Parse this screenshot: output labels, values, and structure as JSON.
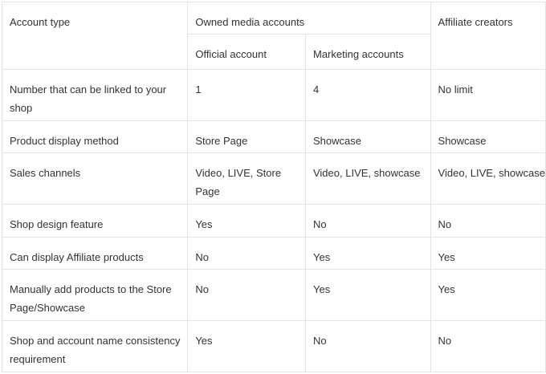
{
  "table": {
    "header": {
      "account_type": "Account type",
      "owned_media": "Owned media accounts",
      "affiliate_creators": "Affiliate creators",
      "official_account": "Official account",
      "marketing_accounts": "Marketing accounts"
    },
    "rows": [
      {
        "label": "Number that can be linked to your shop",
        "official": "1",
        "marketing": "4",
        "affiliate": "No limit"
      },
      {
        "label": "Product display method",
        "official": "Store Page",
        "marketing": "Showcase",
        "affiliate": "Showcase"
      },
      {
        "label": "Sales channels",
        "official": "Video, LIVE, Store Page",
        "marketing": "Video, LIVE, showcase",
        "affiliate": "Video, LIVE, showcase"
      },
      {
        "label": "Shop design feature",
        "official": "Yes",
        "marketing": "No",
        "affiliate": "No"
      },
      {
        "label": "Can display Affiliate products",
        "official": "No",
        "marketing": "Yes",
        "affiliate": "Yes"
      },
      {
        "label": "Manually add products to the Store Page/Showcase",
        "official": "No",
        "marketing": "Yes",
        "affiliate": "Yes"
      },
      {
        "label": "Shop and account name consistency requirement",
        "official": "Yes",
        "marketing": "No",
        "affiliate": "No"
      }
    ]
  }
}
